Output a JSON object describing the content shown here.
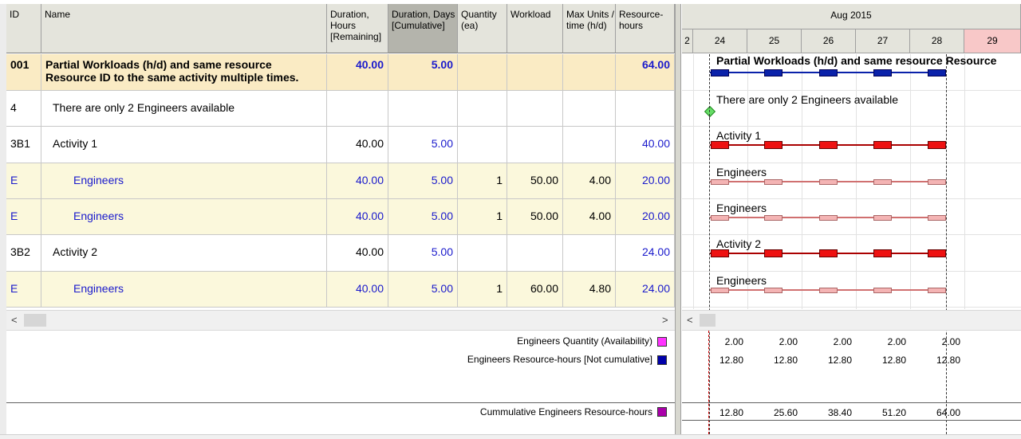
{
  "columns": {
    "id": "ID",
    "name": "Name",
    "duration_hours": "Duration, Hours [Remaining]",
    "duration_days": "Duration, Days [Cumulative]",
    "quantity": "Quantity (ea)",
    "workload": "Workload",
    "max_units": "Max Units / time (h/d)",
    "resource_hours": "Resource- hours"
  },
  "rows": [
    {
      "id": "001",
      "name": "Partial Workloads (h/d) and same resource Resource ID to the same activity multiple times.",
      "dur_hours": "40.00",
      "dur_days": "5.00",
      "quantity": "",
      "workload": "",
      "max_units": "",
      "resource_hours": "64.00"
    },
    {
      "id": "4",
      "name": "There are only 2 Engineers available",
      "dur_hours": "",
      "dur_days": "",
      "quantity": "",
      "workload": "",
      "max_units": "",
      "resource_hours": ""
    },
    {
      "id": "3B1",
      "name": "Activity 1",
      "dur_hours": "40.00",
      "dur_days": "5.00",
      "quantity": "",
      "workload": "",
      "max_units": "",
      "resource_hours": "40.00"
    },
    {
      "id": "E",
      "name": "Engineers",
      "dur_hours": "40.00",
      "dur_days": "5.00",
      "quantity": "1",
      "workload": "50.00",
      "max_units": "4.00",
      "resource_hours": "20.00"
    },
    {
      "id": "E",
      "name": "Engineers",
      "dur_hours": "40.00",
      "dur_days": "5.00",
      "quantity": "1",
      "workload": "50.00",
      "max_units": "4.00",
      "resource_hours": "20.00"
    },
    {
      "id": "3B2",
      "name": "Activity 2",
      "dur_hours": "40.00",
      "dur_days": "5.00",
      "quantity": "",
      "workload": "",
      "max_units": "",
      "resource_hours": "24.00"
    },
    {
      "id": "E",
      "name": "Engineers",
      "dur_hours": "40.00",
      "dur_days": "5.00",
      "quantity": "1",
      "workload": "60.00",
      "max_units": "4.80",
      "resource_hours": "24.00"
    }
  ],
  "gantt": {
    "month": "Aug 2015",
    "days": [
      "2",
      "24",
      "25",
      "26",
      "27",
      "28",
      "29"
    ],
    "bar_labels": [
      "Partial Workloads (h/d) and same resource Resource",
      "There are only 2 Engineers available",
      "Activity 1",
      "Engineers",
      "Engineers",
      "Activity 2",
      "Engineers"
    ]
  },
  "histogram": {
    "legend": [
      {
        "label": "Engineers Quantity (Availability)",
        "color": "#ff33ff"
      },
      {
        "label": "Engineers Resource-hours [Not cumulative]",
        "color": "#0000aa"
      },
      {
        "label": "Cummulative Engineers Resource-hours",
        "color": "#aa00aa"
      }
    ],
    "quantity": [
      "2.00",
      "2.00",
      "2.00",
      "2.00",
      "2.00"
    ],
    "hours": [
      "12.80",
      "12.80",
      "12.80",
      "12.80",
      "12.80"
    ],
    "cumulative": [
      "12.80",
      "25.60",
      "38.40",
      "51.20",
      "64.00"
    ]
  },
  "scroll": {
    "left": "<",
    "right": ">",
    "gantt_left": "<"
  },
  "colors": {
    "summary_bar": "#0a22aa",
    "activity_bar": "#ee1111",
    "resource_bar": "#f4b4b4",
    "row_yellow": "#fbf8dc",
    "row_summary": "#faebc4",
    "today": "#cc0000"
  }
}
